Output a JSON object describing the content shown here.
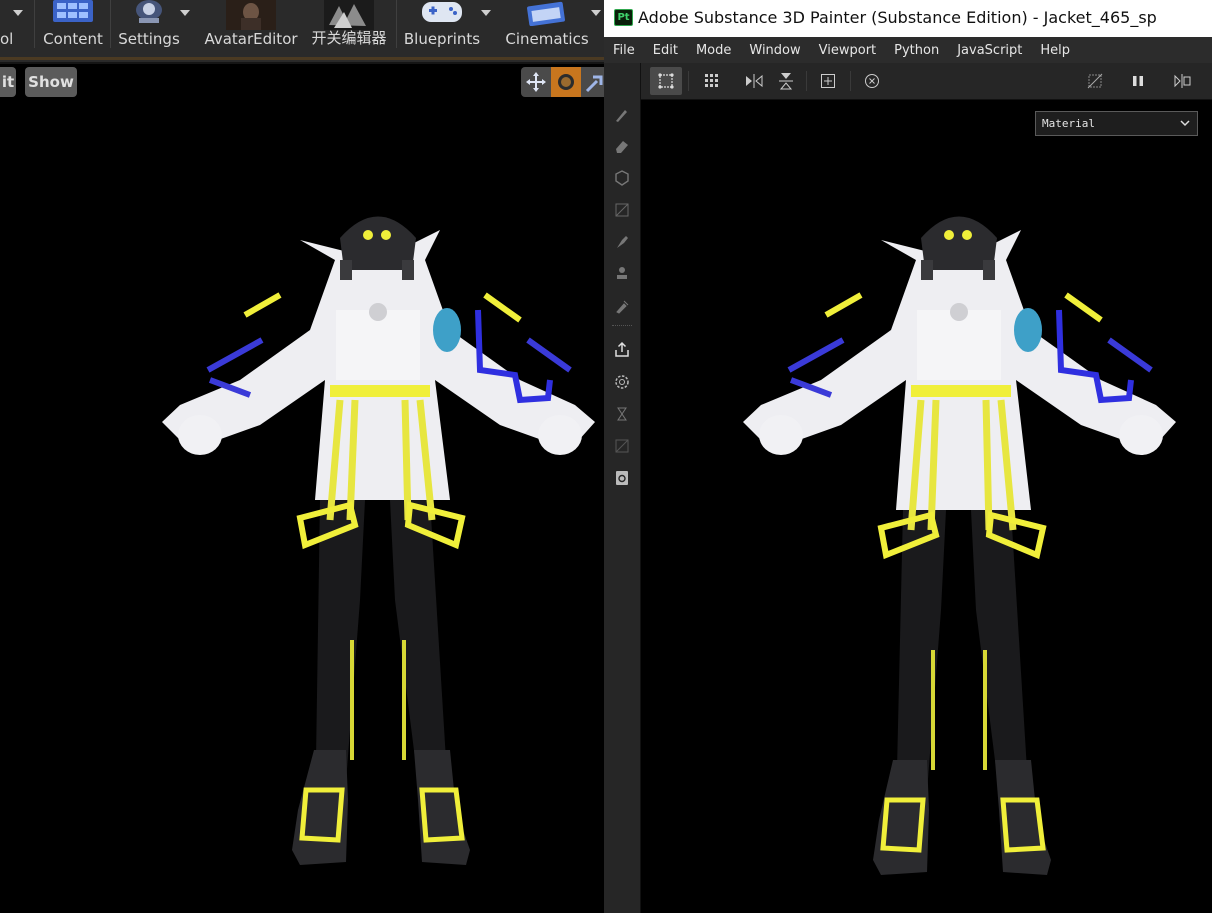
{
  "unreal": {
    "toolbar": {
      "items": [
        {
          "label": "ol",
          "icon": "tool-icon"
        },
        {
          "label": "Content",
          "icon": "content-grid-icon"
        },
        {
          "label": "Settings",
          "icon": "settings-gear-icon"
        },
        {
          "label": "AvatarEditor",
          "icon": "avatar-thumbnail-icon"
        },
        {
          "label": "开关编辑器",
          "icon": "switch-editor-thumbnail-icon"
        },
        {
          "label": "Blueprints",
          "icon": "gamepad-icon"
        },
        {
          "label": "Cinematics",
          "icon": "clapperboard-icon"
        }
      ]
    },
    "viewport": {
      "buttons": {
        "edit_fragment": "it",
        "show": "Show"
      }
    }
  },
  "painter": {
    "window_title": "Adobe Substance 3D Painter (Substance Edition) - Jacket_465_sp",
    "logo_text": "Pt",
    "menu": [
      "File",
      "Edit",
      "Mode",
      "Window",
      "Viewport",
      "Python",
      "JavaScript",
      "Help"
    ],
    "viewport": {
      "display_mode": "Material"
    }
  },
  "colors": {
    "accent_orange": "#c8761e",
    "jacket_white": "#eeeef2",
    "strap_yellow": "#f0ef3a",
    "logo_green": "#31a84f"
  }
}
